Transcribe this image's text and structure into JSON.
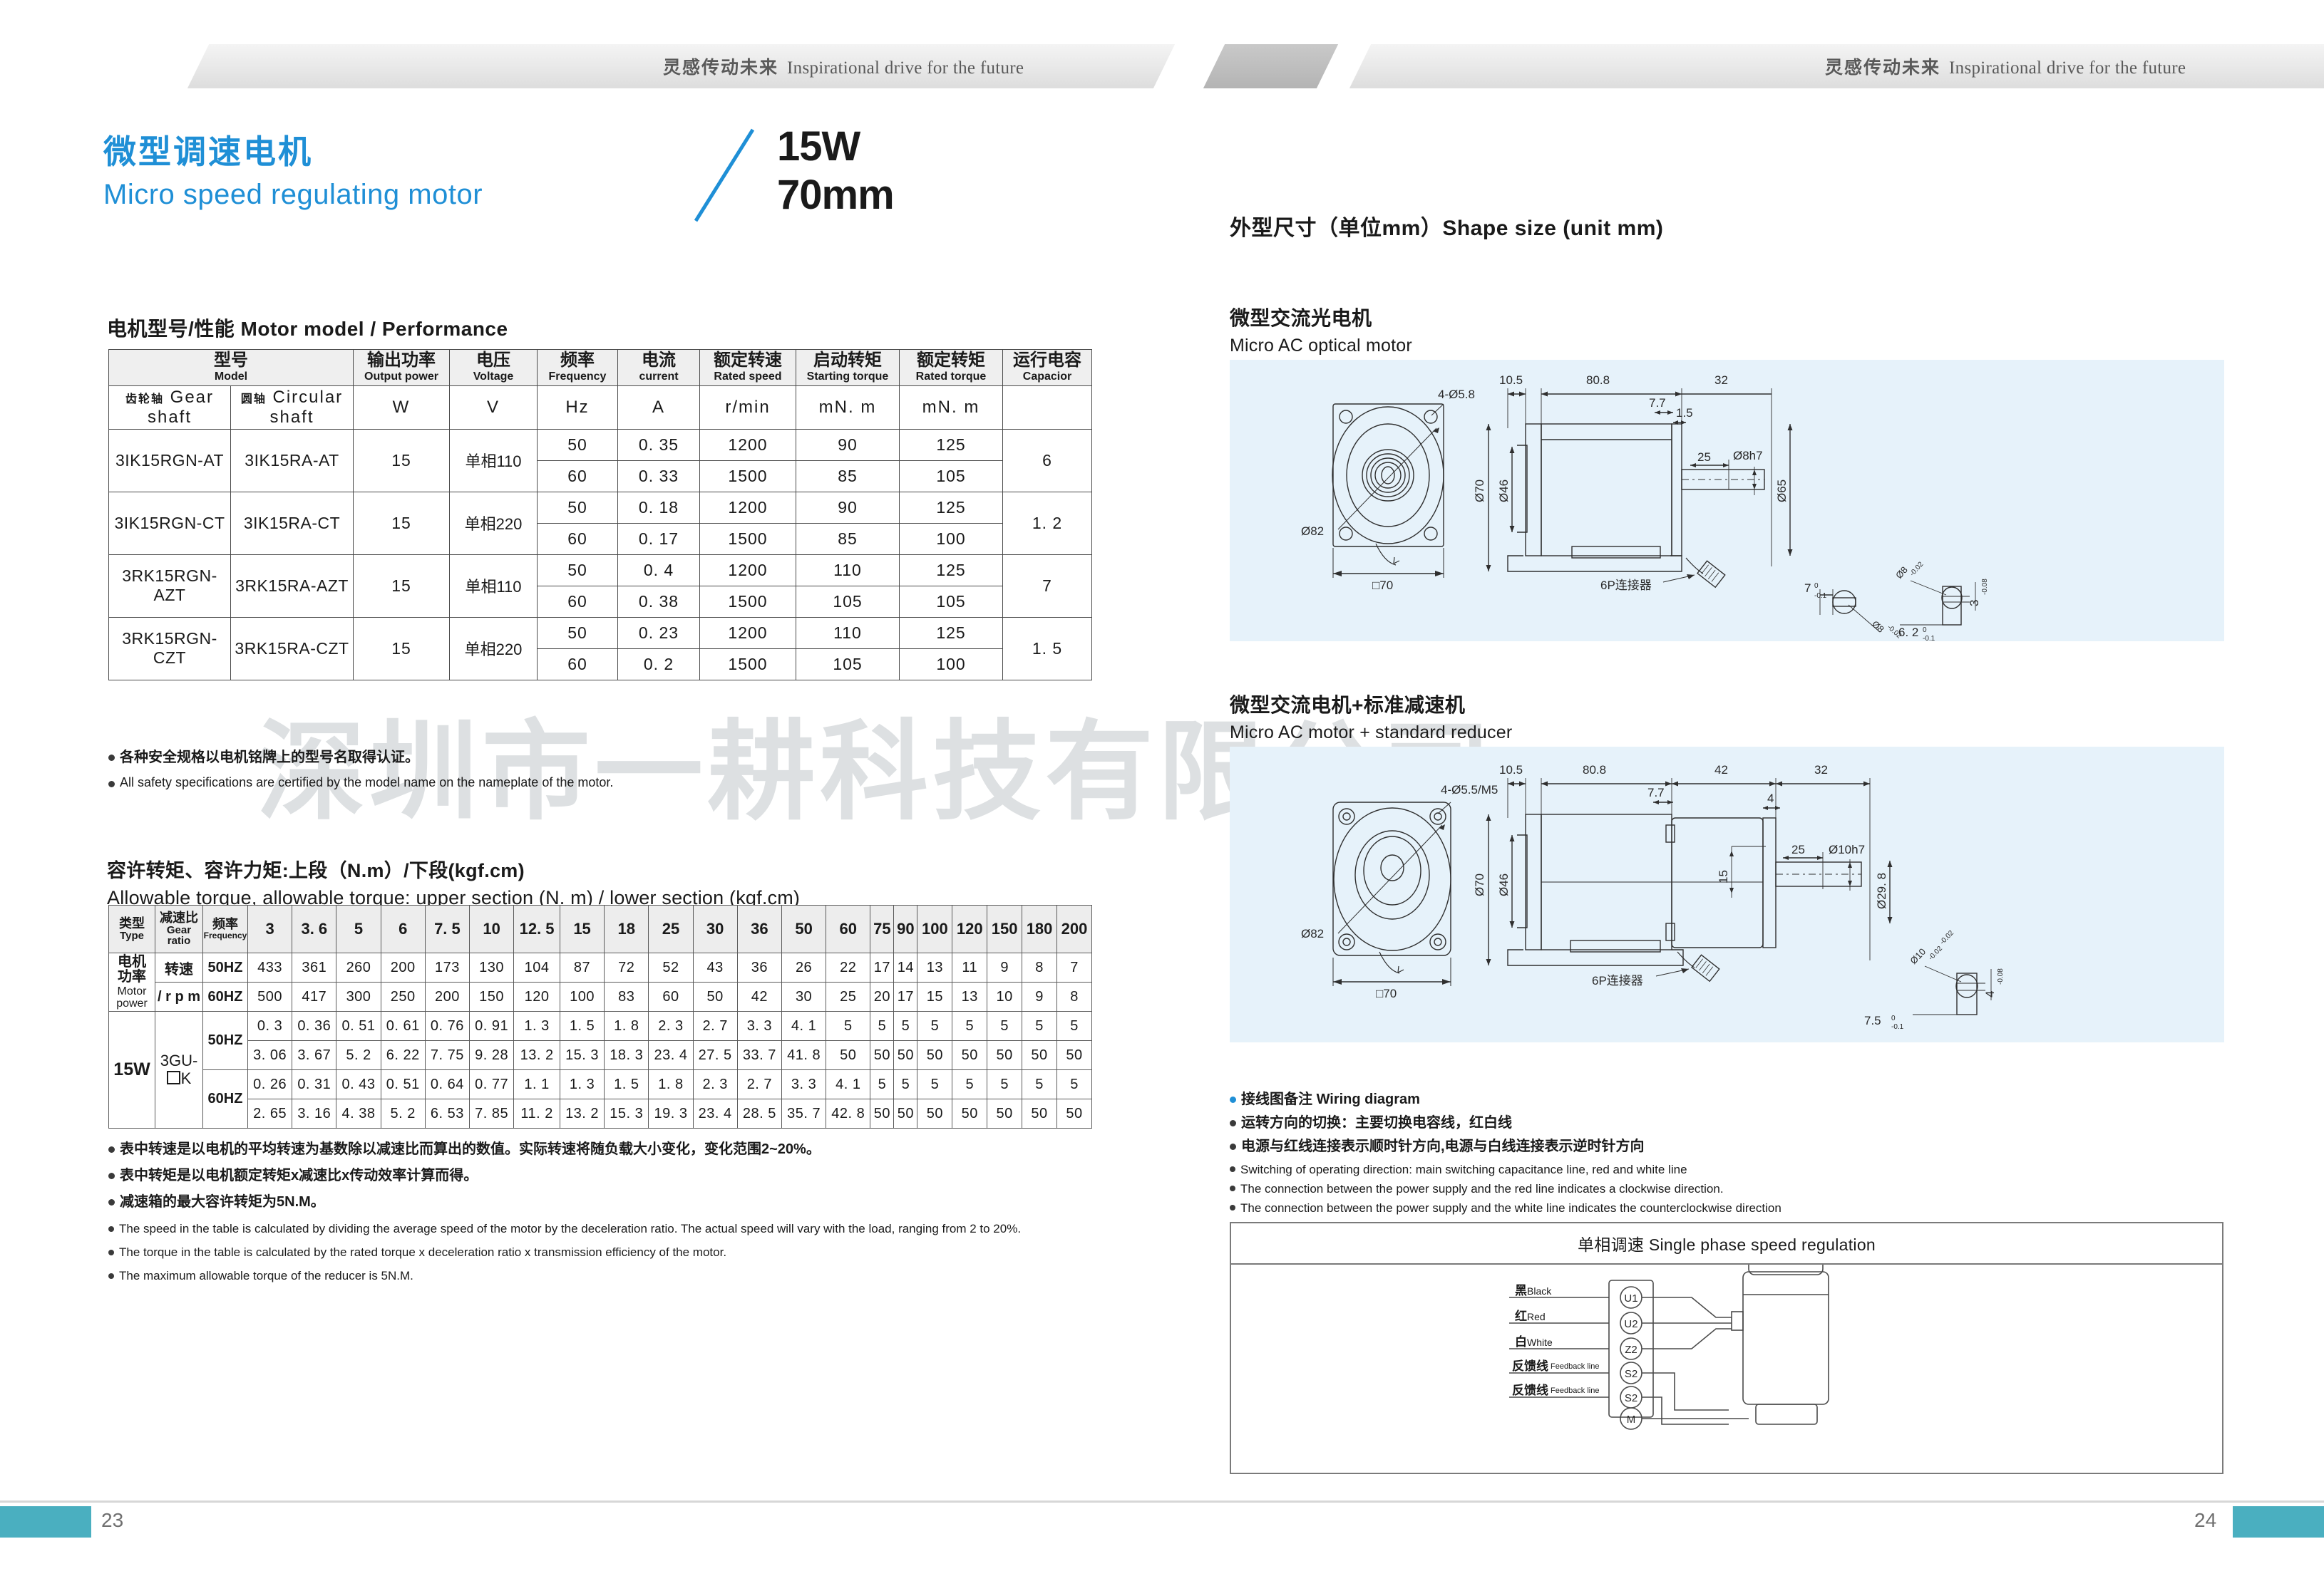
{
  "banner": {
    "slogan_cn": "灵感传动未来",
    "slogan_en": "Inspirational drive for the future"
  },
  "title": {
    "cn": "微型调速电机",
    "en": "Micro speed regulating motor",
    "power": "15W",
    "frame": "70mm"
  },
  "watermark": "深圳市一耕科技有限公司",
  "perf": {
    "heading": "电机型号/性能 Motor model / Performance",
    "headers": [
      {
        "cn": "型号",
        "en": "Model"
      },
      {
        "cn": "输出功率",
        "en": "Output power"
      },
      {
        "cn": "电压",
        "en": "Voltage"
      },
      {
        "cn": "频率",
        "en": "Frequency"
      },
      {
        "cn": "电流",
        "en": "current"
      },
      {
        "cn": "额定转速",
        "en": "Rated speed"
      },
      {
        "cn": "启动转矩",
        "en": "Starting torque"
      },
      {
        "cn": "额定转矩",
        "en": "Rated torque"
      },
      {
        "cn": "运行电容",
        "en": "Capacior"
      }
    ],
    "sub_headers": {
      "gear_cn": "齿轮轴",
      "gear_en": "Gear shaft",
      "circ_cn": "圆轴",
      "circ_en": "Circular shaft"
    },
    "units": [
      "W",
      "V",
      "Hz",
      "A",
      "r/min",
      "mN. m",
      "mN. m"
    ],
    "rows": [
      {
        "gear_model": "3IK15RGN-AT",
        "circ_model": "3IK15RA-AT",
        "power": "15",
        "voltage": "单相110",
        "capacitor": "6",
        "lines": [
          {
            "freq": "50",
            "current": "0. 35",
            "speed": "1200",
            "start_torque": "90",
            "rated_torque": "125"
          },
          {
            "freq": "60",
            "current": "0. 33",
            "speed": "1500",
            "start_torque": "85",
            "rated_torque": "105"
          }
        ]
      },
      {
        "gear_model": "3IK15RGN-CT",
        "circ_model": "3IK15RA-CT",
        "power": "15",
        "voltage": "单相220",
        "capacitor": "1. 2",
        "lines": [
          {
            "freq": "50",
            "current": "0. 18",
            "speed": "1200",
            "start_torque": "90",
            "rated_torque": "125"
          },
          {
            "freq": "60",
            "current": "0. 17",
            "speed": "1500",
            "start_torque": "85",
            "rated_torque": "100"
          }
        ]
      },
      {
        "gear_model": "3RK15RGN-AZT",
        "circ_model": "3RK15RA-AZT",
        "power": "15",
        "voltage": "单相110",
        "capacitor": "7",
        "lines": [
          {
            "freq": "50",
            "current": "0. 4",
            "speed": "1200",
            "start_torque": "110",
            "rated_torque": "125"
          },
          {
            "freq": "60",
            "current": "0. 38",
            "speed": "1500",
            "start_torque": "105",
            "rated_torque": "105"
          }
        ]
      },
      {
        "gear_model": "3RK15RGN-CZT",
        "circ_model": "3RK15RA-CZT",
        "power": "15",
        "voltage": "单相220",
        "capacitor": "1. 5",
        "lines": [
          {
            "freq": "50",
            "current": "0. 23",
            "speed": "1200",
            "start_torque": "110",
            "rated_torque": "125"
          },
          {
            "freq": "60",
            "current": "0. 2",
            "speed": "1500",
            "start_torque": "105",
            "rated_torque": "100"
          }
        ]
      }
    ]
  },
  "safety_notes": [
    "各种安全规格以电机铭牌上的型号名取得认证。",
    "All safety specifications are certified by the model name on the nameplate of the motor."
  ],
  "torque": {
    "heading_cn": "容许转矩、容许力矩:上段（N.m）/下段(kgf.cm)",
    "heading_en": "Allowable torque, allowable torque: upper section (N. m) / lower section (kgf.cm)",
    "corner": {
      "type_cn": "类型",
      "type_en": "Type",
      "ratio_cn": "减速比",
      "ratio_en1": "Gear",
      "ratio_en2": "ratio",
      "freq_cn": "频率",
      "freq_en": "Frequency"
    },
    "ratios": [
      "3",
      "3. 6",
      "5",
      "6",
      "7. 5",
      "10",
      "12. 5",
      "15",
      "18",
      "25",
      "30",
      "36",
      "50",
      "60",
      "75",
      "90",
      "100",
      "120",
      "150",
      "180",
      "200"
    ],
    "speed_label": {
      "cn1": "电机",
      "cn2": "功率",
      "en1": "Motor",
      "en2": "power",
      "rot_cn": "转速",
      "rot_en": "/ r p m"
    },
    "speed_50hz_label": "50HZ",
    "speed_60hz_label": "60HZ",
    "speed_50hz": [
      "433",
      "361",
      "260",
      "200",
      "173",
      "130",
      "104",
      "87",
      "72",
      "52",
      "43",
      "36",
      "26",
      "22",
      "17",
      "14",
      "13",
      "11",
      "9",
      "8",
      "7"
    ],
    "speed_60hz": [
      "500",
      "417",
      "300",
      "250",
      "200",
      "150",
      "120",
      "100",
      "83",
      "60",
      "50",
      "42",
      "30",
      "25",
      "20",
      "17",
      "15",
      "13",
      "10",
      "9",
      "8"
    ],
    "power_label": "15W",
    "gear_label1": "3GU-",
    "gear_label2": "K",
    "t50_nm": [
      "0. 3",
      "0. 36",
      "0. 51",
      "0. 61",
      "0. 76",
      "0. 91",
      "1. 3",
      "1. 5",
      "1. 8",
      "2. 3",
      "2. 7",
      "3. 3",
      "4. 1",
      "5",
      "5",
      "5",
      "5",
      "5",
      "5",
      "5",
      "5"
    ],
    "t50_kgf": [
      "3. 06",
      "3. 67",
      "5. 2",
      "6. 22",
      "7. 75",
      "9. 28",
      "13. 2",
      "15. 3",
      "18. 3",
      "23. 4",
      "27. 5",
      "33. 7",
      "41. 8",
      "50",
      "50",
      "50",
      "50",
      "50",
      "50",
      "50",
      "50"
    ],
    "t60_nm": [
      "0. 26",
      "0. 31",
      "0. 43",
      "0. 51",
      "0. 64",
      "0. 77",
      "1. 1",
      "1. 3",
      "1. 5",
      "1. 8",
      "2. 3",
      "2. 7",
      "3. 3",
      "4. 1",
      "5",
      "5",
      "5",
      "5",
      "5",
      "5",
      "5"
    ],
    "t60_kgf": [
      "2. 65",
      "3. 16",
      "4. 38",
      "5. 2",
      "6. 53",
      "7. 85",
      "11. 2",
      "13. 2",
      "15. 3",
      "19. 3",
      "23. 4",
      "28. 5",
      "35. 7",
      "42. 8",
      "50",
      "50",
      "50",
      "50",
      "50",
      "50",
      "50"
    ]
  },
  "torque_notes": {
    "cn": [
      "表中转速是以电机的平均转速为基数除以减速比而算出的数值。实际转速将随负载大小变化，变化范围2~20%。",
      "表中转矩是以电机额定转矩x减速比x传动效率计算而得。",
      "减速箱的最大容许转矩为5N.M。"
    ],
    "en": [
      "The speed in the table is calculated by dividing the average speed of the motor by the deceleration ratio. The actual speed will vary with the load, ranging from 2 to 20%.",
      "The torque in the table is calculated by the rated torque x deceleration ratio x transmission efficiency of the motor.",
      "The maximum allowable torque of the reducer is 5N.M."
    ]
  },
  "shape": {
    "heading": "外型尺寸（单位mm）Shape size (unit mm)",
    "drawing1": {
      "title_cn": "微型交流光电机",
      "title_en": "Micro AC optical motor",
      "dims": {
        "holes": "4-Ø5.8",
        "flange_dia": "Ø82",
        "square": "70",
        "front_len": "10.5",
        "body_len": "80.8",
        "shaft_sec": "32",
        "step1": "7.7",
        "step2": "1.5",
        "boss_dia": "Ø70",
        "pilot_dia": "Ø46",
        "shaft_len": "25",
        "shaft_dia": "Ø8h7",
        "end_dia": "Ø65",
        "connector": "6P连接器",
        "key_w": "7",
        "key_tol": "-0.1",
        "key_shaft": "Ø8",
        "key_shaft_tol": "-0.02",
        "key_h": "6. 2",
        "key_h_tol": "-0.1",
        "key_t": "3",
        "key_t_tol": "-0.08"
      }
    },
    "drawing2": {
      "title_cn": "微型交流电机+标准减速机",
      "title_en": "Micro AC motor + standard reducer",
      "dims": {
        "holes": "4-Ø5.5/M5",
        "flange_dia": "Ø82",
        "square": "70",
        "front_len": "10.5",
        "body_len": "80.8",
        "reducer_len": "42",
        "shaft_sec": "32",
        "step1": "7.7",
        "step2": "4",
        "boss_dia": "Ø70",
        "pilot_dia": "Ø46",
        "boss_h": "15",
        "shaft_len": "25",
        "shaft_dia": "Ø10h7",
        "end_dia": "Ø29. 8",
        "connector": "6P连接器",
        "key_w": "7.5",
        "key_tol": "-0.1",
        "key_shaft": "Ø10",
        "key_shaft_tol": "-0.02",
        "key_t": "4",
        "key_t_tol": "-0.08"
      }
    }
  },
  "wiring": {
    "note_title_cn": "接线图备注",
    "note_title_en": "Wiring diagram",
    "notes_cn": [
      "运转方向的切换：主要切换电容线，红白线",
      "电源与红线连接表示顺时针方向,电源与白线连接表示逆时针方向"
    ],
    "notes_en": [
      "Switching of operating direction: main switching capacitance line, red and white line",
      "The connection between the power supply and the red line indicates a clockwise direction.",
      "The connection between the power supply and the white line indicates the counterclockwise direction"
    ],
    "box_title": "单相调速 Single phase speed regulation",
    "terminals": [
      {
        "cn": "黑",
        "en": "Black",
        "code": "U1"
      },
      {
        "cn": "红",
        "en": "Red",
        "code": "U2"
      },
      {
        "cn": "白",
        "en": "White",
        "code": "Z2"
      },
      {
        "cn": "反馈线",
        "en": "Feedback line",
        "code": "S2"
      },
      {
        "cn": "反馈线",
        "en": "Feedback line",
        "code": "S2"
      },
      {
        "cn": "",
        "en": "",
        "code": "M"
      }
    ]
  },
  "footer": {
    "page_left": "23",
    "page_right": "24"
  },
  "colors": {
    "brand_blue": "#1f8fd6",
    "drawing_bg": "#e6f2fa",
    "page_chip": "#4aafc0"
  }
}
